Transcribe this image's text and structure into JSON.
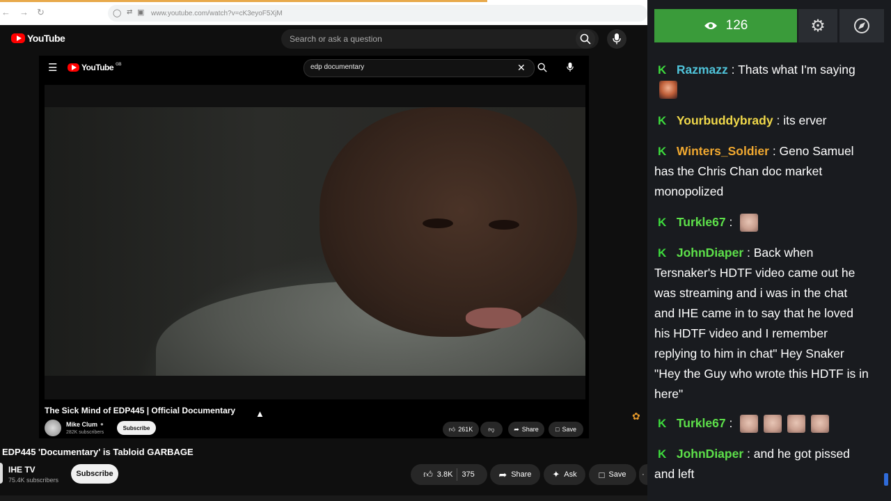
{
  "browser": {
    "url": "www.youtube.com/watch?v=cK3eyoF5XjM"
  },
  "outer_header": {
    "logo": "YouTube",
    "search_placeholder": "Search or ask a question"
  },
  "inner_page": {
    "logo": "YouTube",
    "logo_region": "GB",
    "search_query": "edp documentary",
    "video_title": "The Sick Mind of EDP445 | Official Documentary",
    "channel_name": "Mike Clum",
    "subscribers": "282K subscribers",
    "subscribe_label": "Subscribe",
    "likes": "261K",
    "share_label": "Share",
    "save_label": "Save"
  },
  "outer_info": {
    "title": "EDP445 'Documentary' is Tabloid GARBAGE",
    "channel_name": "IHE TV",
    "subscribers": "75.4K subscribers",
    "subscribe_label": "Subscribe",
    "likes": "3.8K",
    "dislikes": "375",
    "share_label": "Share",
    "ask_label": "Ask",
    "save_label": "Save"
  },
  "chat": {
    "viewer_count": "126",
    "badge": "K",
    "messages": [
      {
        "user": "Razmazz",
        "text": ": Thats what I'm saying",
        "color": "#4fc3d9"
      },
      {
        "user": "Yourbuddybrady",
        "text": ": its erver",
        "color": "#f0d84a"
      },
      {
        "user": "Winters_Soldier",
        "text": ": Geno Samuel has the Chris Chan doc market monopolized",
        "color": "#f0a830"
      },
      {
        "user": "Turkle67",
        "text": " :",
        "color": "#5de04a"
      },
      {
        "user": "JohnDiaper",
        "text": ": Back when Tersnaker's HDTF video came out he was streaming and i was in the chat and IHE came in to say that he loved his HDTF video and I remember replying to him in chat\" Hey Snaker \"Hey the Guy who wrote this HDTF is in here\"",
        "color": "#5de04a"
      },
      {
        "user": "Turkle67",
        "text": " :",
        "color": "#5de04a"
      },
      {
        "user": "JohnDiaper",
        "text": ": and he got pissed and left",
        "color": "#5de04a"
      }
    ]
  }
}
